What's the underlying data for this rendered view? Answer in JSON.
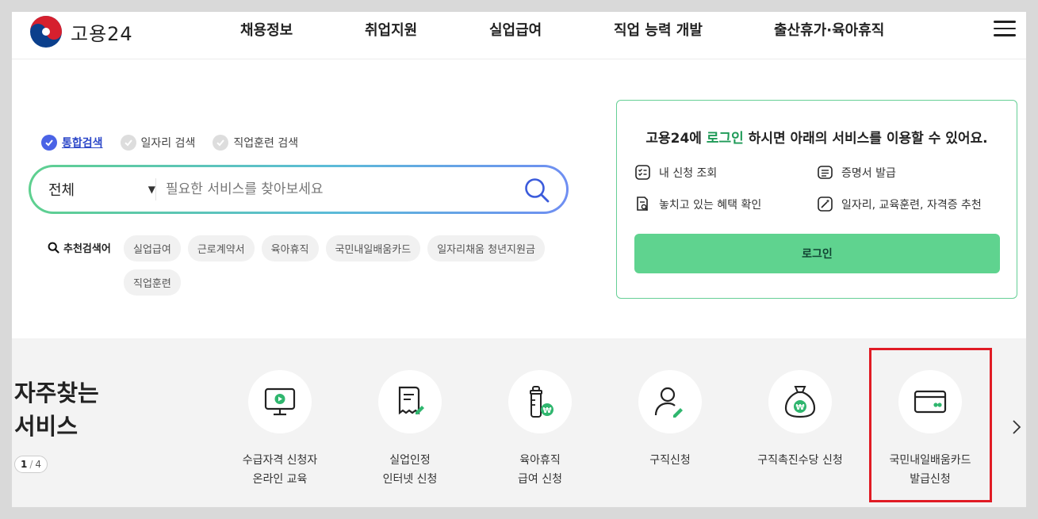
{
  "header": {
    "logo_text": "고용24",
    "nav": [
      "채용정보",
      "취업지원",
      "실업급여",
      "직업 능력 개발",
      "출산휴가·육아휴직"
    ]
  },
  "search": {
    "types": [
      {
        "label": "통합검색",
        "selected": true
      },
      {
        "label": "일자리 검색",
        "selected": false
      },
      {
        "label": "직업훈련 검색",
        "selected": false
      }
    ],
    "scope_value": "전체",
    "placeholder": "필요한 서비스를 찾아보세요",
    "recommend_title": "추천검색어",
    "chips": [
      "실업급여",
      "근로계약서",
      "육아휴직",
      "국민내일배움카드",
      "일자리채움 청년지원금",
      "직업훈련"
    ]
  },
  "login": {
    "msg_prefix": "고용24에 ",
    "msg_highlight": "로그인",
    "msg_suffix": " 하시면 아래의 서비스를 이용할 수 있어요.",
    "services": [
      "내 신청 조회",
      "증명서 발급",
      "놓치고 있는 혜택 확인",
      "일자리, 교육훈련, 자격증 추천"
    ],
    "button_label": "로그인"
  },
  "frequent": {
    "title_line1": "자주찾는",
    "title_line2": "서비스",
    "page_current": "1",
    "page_sep": "/",
    "page_total": "4",
    "items": [
      {
        "label": "수급자격 신청자\n온라인 교육",
        "icon": "monitor-play-icon"
      },
      {
        "label": "실업인정\n인터넷 신청",
        "icon": "receipt-pencil-icon"
      },
      {
        "label": "육아휴직\n급여 신청",
        "icon": "baby-bottle-won-icon"
      },
      {
        "label": "구직신청",
        "icon": "person-pencil-icon"
      },
      {
        "label": "구직촉진수당 신청",
        "icon": "money-bag-won-icon"
      },
      {
        "label": "국민내일배움카드\n발급신청",
        "icon": "card-icon"
      }
    ]
  },
  "colors": {
    "accent_green": "#5fd38f",
    "login_highlight": "#1e9a57",
    "selected_blue": "#4a63e6",
    "highlight_red": "#e01b24"
  }
}
